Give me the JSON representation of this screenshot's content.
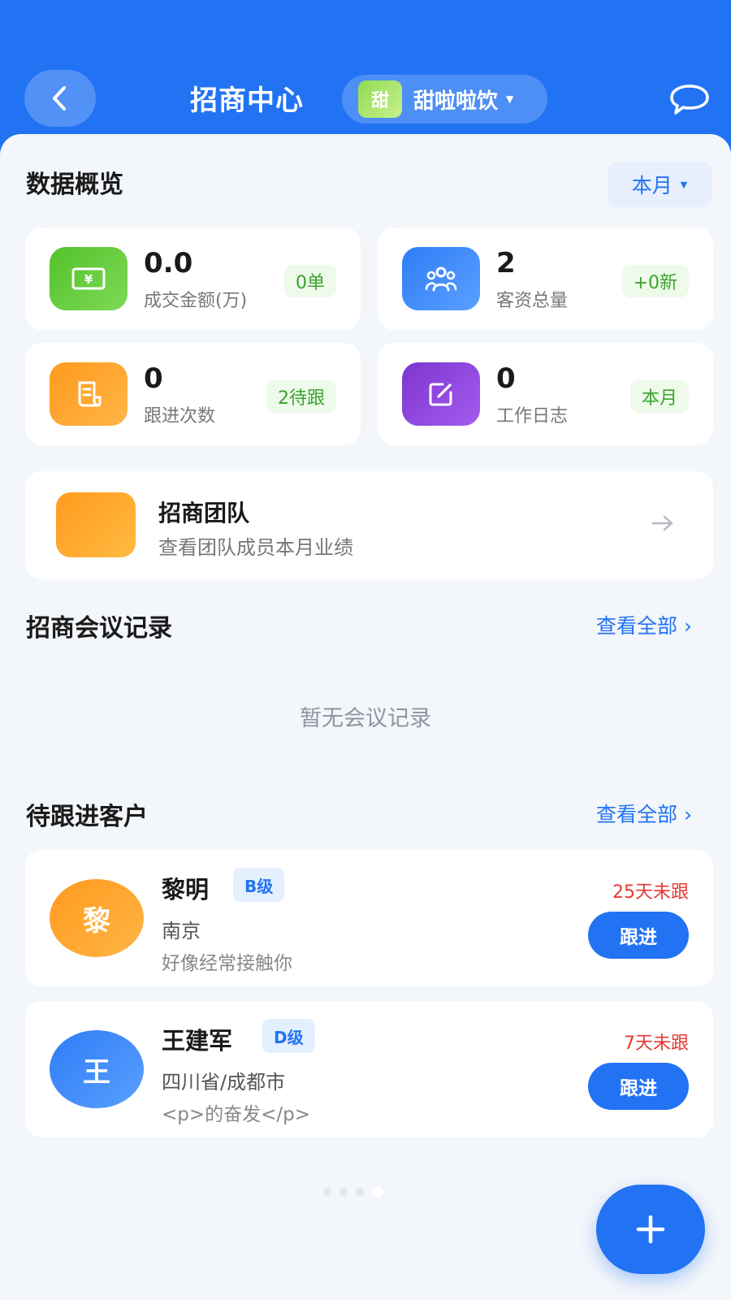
{
  "header": {
    "title": "招商中心",
    "brand": {
      "logo_text": "甜",
      "name": "甜啦啦饮"
    },
    "back_icon": "chevron-left-icon",
    "message_icon": "chat-bubble-icon"
  },
  "overview": {
    "title": "数据概览",
    "period": "本月",
    "stats": [
      {
        "value": "0.0",
        "label": "成交金额(万)",
        "badge": "0单",
        "icon": "yuan-bill-icon",
        "color": "#57c42d"
      },
      {
        "value": "2",
        "label": "客资总量",
        "badge": "+0新",
        "icon": "people-icon",
        "color": "#2f7cf6"
      },
      {
        "value": "0",
        "label": "跟进次数",
        "badge": "2待跟",
        "icon": "document-icon",
        "color": "#ff9d1c"
      },
      {
        "value": "0",
        "label": "工作日志",
        "badge": "本月",
        "icon": "edit-icon",
        "color": "#8a43d8"
      }
    ]
  },
  "team": {
    "title": "招商团队",
    "subtitle": "查看团队成员本月业绩"
  },
  "meetings": {
    "title": "招商会议记录",
    "view_all": "查看全部",
    "empty_text": "暂无会议记录"
  },
  "customers": {
    "title": "待跟进客户",
    "view_all": "查看全部",
    "follow_label": "跟进",
    "items": [
      {
        "avatar": "黎",
        "name": "黎明",
        "level": "B级",
        "city": "南京",
        "note": "好像经常接触你",
        "overdue": "25天未跟",
        "avatar_color": "#ff9a1e"
      },
      {
        "avatar": "王",
        "name": "王建军",
        "level": "D级",
        "city": "四川省/成都市",
        "note": "<p>的奋发</p>",
        "overdue": "7天未跟",
        "avatar_color": "#2f7cf6"
      }
    ]
  },
  "pagination": {
    "count": 4,
    "active": 4
  },
  "fab_icon": "plus-icon"
}
